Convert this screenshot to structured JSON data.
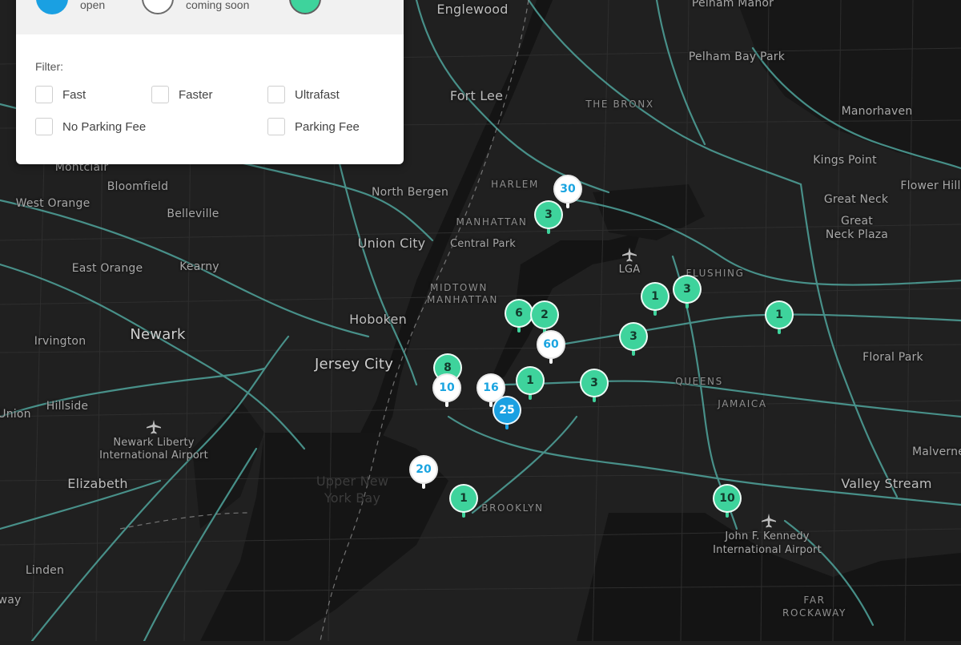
{
  "legend": {
    "items": [
      {
        "label": "open",
        "fill": "#1aa0e2"
      },
      {
        "label": "coming soon",
        "fill": "#ffffff"
      },
      {
        "label": "",
        "fill": "#3ed39c"
      }
    ]
  },
  "filter": {
    "title": "Filter:",
    "options": [
      {
        "label": "Fast",
        "checked": false
      },
      {
        "label": "Faster",
        "checked": false
      },
      {
        "label": "Ultrafast",
        "checked": false
      },
      {
        "label": "No Parking Fee",
        "checked": false
      },
      {
        "label": "Parking Fee",
        "checked": false
      }
    ]
  },
  "places": [
    {
      "name": "Englewood"
    },
    {
      "name": "Pelham Manor"
    },
    {
      "name": "Pelham Bay Park"
    },
    {
      "name": "Fort Lee"
    },
    {
      "name": "THE BRONX"
    },
    {
      "name": "Manorhaven"
    },
    {
      "name": "Kings Point"
    },
    {
      "name": "Montclair"
    },
    {
      "name": "Bloomfield"
    },
    {
      "name": "HARLEM"
    },
    {
      "name": "Flower Hill"
    },
    {
      "name": "West Orange"
    },
    {
      "name": "North Bergen"
    },
    {
      "name": "Great Neck"
    },
    {
      "name": "Belleville"
    },
    {
      "name": "MANHATTAN"
    },
    {
      "name": "Great Neck Plaza"
    },
    {
      "name": "Union City"
    },
    {
      "name": "Central Park"
    },
    {
      "name": "East Orange"
    },
    {
      "name": "Kearny"
    },
    {
      "name": "LGA"
    },
    {
      "name": "FLUSHING"
    },
    {
      "name": "MIDTOWN MANHATTAN"
    },
    {
      "name": "Hoboken"
    },
    {
      "name": "Newark"
    },
    {
      "name": "Irvington"
    },
    {
      "name": "Floral Park"
    },
    {
      "name": "Jersey City"
    },
    {
      "name": "QUEENS"
    },
    {
      "name": "JAMAICA"
    },
    {
      "name": "Union"
    },
    {
      "name": "Hillside"
    },
    {
      "name": "Newark Liberty International Airport"
    },
    {
      "name": "Malverne"
    },
    {
      "name": "Upper New York Bay"
    },
    {
      "name": "Elizabeth"
    },
    {
      "name": "Valley Stream"
    },
    {
      "name": "BROOKLYN"
    },
    {
      "name": "John F. Kennedy International Airport"
    },
    {
      "name": "Linden"
    },
    {
      "name": "way"
    },
    {
      "name": "FAR ROCKAWAY"
    }
  ],
  "markers": [
    {
      "count": "30",
      "status": "white"
    },
    {
      "count": "3",
      "status": "green"
    },
    {
      "count": "1",
      "status": "green"
    },
    {
      "count": "3",
      "status": "green"
    },
    {
      "count": "1",
      "status": "green"
    },
    {
      "count": "6",
      "status": "green"
    },
    {
      "count": "2",
      "status": "green"
    },
    {
      "count": "3",
      "status": "green"
    },
    {
      "count": "60",
      "status": "white"
    },
    {
      "count": "8",
      "status": "green"
    },
    {
      "count": "1",
      "status": "green"
    },
    {
      "count": "3",
      "status": "green"
    },
    {
      "count": "10",
      "status": "white"
    },
    {
      "count": "16",
      "status": "white"
    },
    {
      "count": "25",
      "status": "blue"
    },
    {
      "count": "20",
      "status": "white"
    },
    {
      "count": "1",
      "status": "green"
    },
    {
      "count": "10",
      "status": "green"
    }
  ],
  "colors": {
    "land": "#1f1f1f",
    "water": "#111111",
    "roads": "#4fa49c",
    "green_pin": "#3ed39c",
    "blue_pin": "#1aa0e2"
  }
}
